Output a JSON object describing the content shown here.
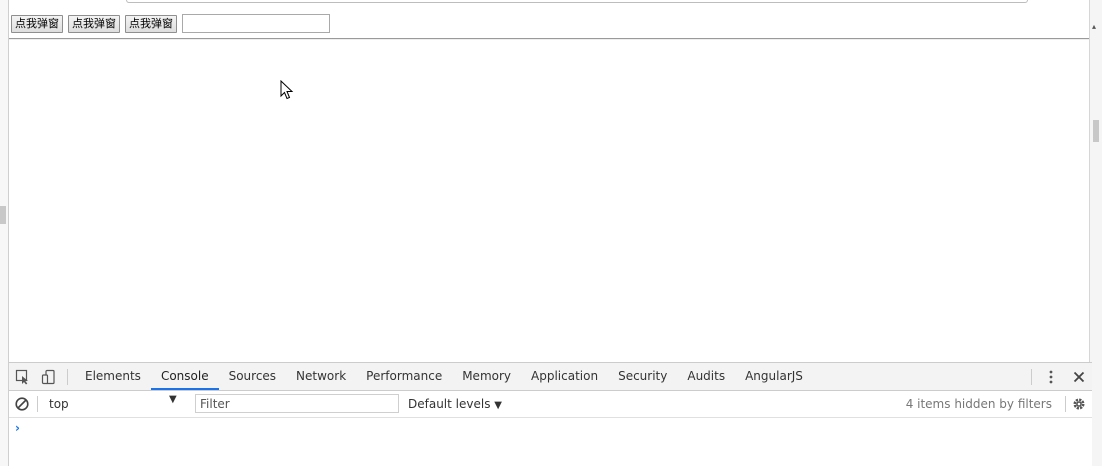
{
  "page": {
    "buttons": [
      "点我弹窗",
      "点我弹窗",
      "点我弹窗"
    ],
    "input_value": ""
  },
  "devtools": {
    "tabs": [
      "Elements",
      "Console",
      "Sources",
      "Network",
      "Performance",
      "Memory",
      "Application",
      "Security",
      "Audits",
      "AngularJS"
    ],
    "active_tab": "Console",
    "context": "top",
    "filter_placeholder": "Filter",
    "levels_label": "Default levels",
    "hidden_count": "4 items hidden by filters",
    "prompt_symbol": "›"
  },
  "icons": {
    "inspect": "inspect-element-icon",
    "device": "device-toggle-icon",
    "kebab": "more-options-icon",
    "close": "close-icon",
    "clear": "clear-console-icon",
    "settings": "gear-icon",
    "cursor": "mouse-cursor-icon"
  },
  "colors": {
    "accent": "#1a73e8",
    "tabbar_bg": "#f3f3f3"
  }
}
